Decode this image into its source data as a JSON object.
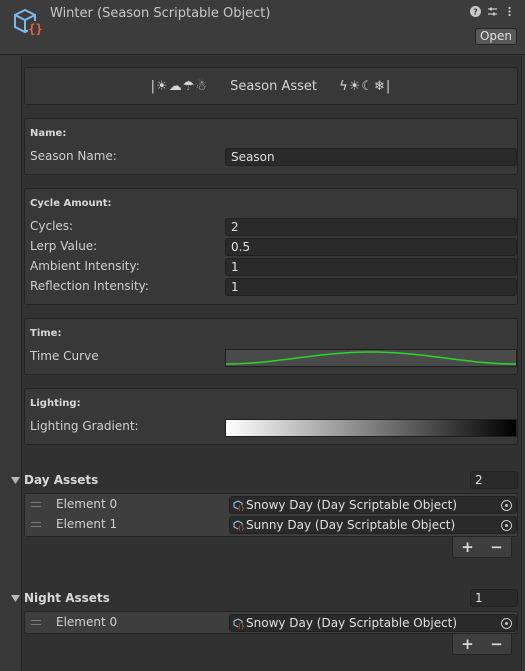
{
  "header": {
    "title": "Winter (Season Scriptable Object)",
    "open_label": "Open",
    "icons": [
      "help-icon",
      "presets-icon",
      "kebab-menu-icon"
    ]
  },
  "banner": {
    "left_glyphs": "|☀☁☂☃",
    "title": "Season Asset",
    "right_glyphs": "ϟ☀☾❄|"
  },
  "name_section": {
    "title": "Name:",
    "season_name_label": "Season Name:",
    "season_name_value": "Season"
  },
  "cycle_section": {
    "title": "Cycle Amount:",
    "cycles_label": "Cycles:",
    "cycles_value": "2",
    "lerp_label": "Lerp Value:",
    "lerp_value": "0.5",
    "ambient_label": "Ambient Intensity:",
    "ambient_value": "1",
    "reflection_label": "Reflection Intensity:",
    "reflection_value": "1"
  },
  "time_section": {
    "title": "Time:",
    "curve_label": "Time Curve",
    "curve_color": "#29d52a"
  },
  "lighting_section": {
    "title": "Lighting:",
    "gradient_label": "Lighting Gradient:"
  },
  "day_assets": {
    "title": "Day Assets",
    "count": "2",
    "elements": [
      {
        "label": "Element 0",
        "value": "Snowy Day (Day Scriptable Object)"
      },
      {
        "label": "Element 1",
        "value": "Sunny Day (Day Scriptable Object)"
      }
    ]
  },
  "night_assets": {
    "title": "Night Assets",
    "count": "1",
    "elements": [
      {
        "label": "Element 0",
        "value": "Snowy Day (Day Scriptable Object)"
      }
    ]
  },
  "list_controls": {
    "add": "+",
    "remove": "−"
  },
  "colors": {
    "background": "#383838",
    "panel": "#313131",
    "field": "#2a2a2a",
    "accent_icon": "#e8663a"
  }
}
